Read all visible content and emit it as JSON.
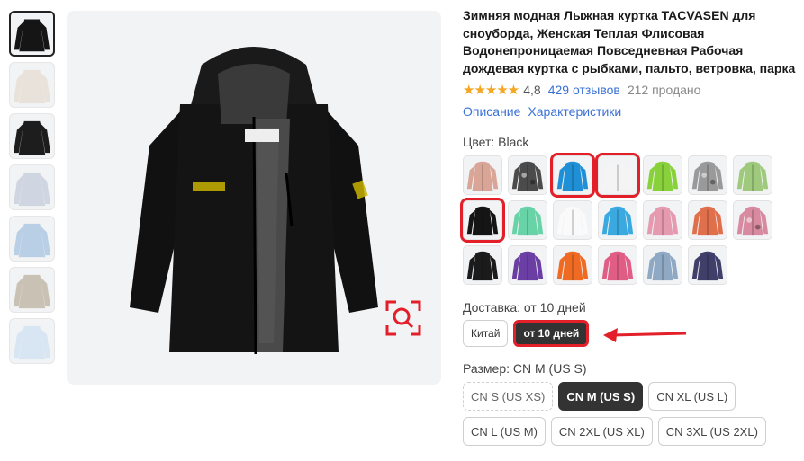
{
  "product": {
    "title": "Зимняя модная Лыжная куртка TACVASEN для сноуборда, Женская Теплая Флисовая Водонепроницаемая Повседневная Рабочая дождевая куртка с рыбками, пальто, ветровка, парка",
    "stars": "★★★★★",
    "rating": "4,8",
    "reviews": "429 отзывов",
    "sold": "212 продано",
    "link_description": "Описание",
    "link_specs": "Характеристики"
  },
  "thumbnails": [
    {
      "name": "thumb-black-jacket",
      "color": "#151515",
      "active": true
    },
    {
      "name": "thumb-hood-detail",
      "color": "#e8e2da"
    },
    {
      "name": "thumb-lining-detail",
      "color": "#1d1d1d"
    },
    {
      "name": "thumb-model-1",
      "color": "#cfd6e2"
    },
    {
      "name": "thumb-model-2",
      "color": "#b9cfe6"
    },
    {
      "name": "thumb-model-3",
      "color": "#c9c1b4"
    },
    {
      "name": "thumb-size-chart",
      "color": "#d8e6f3"
    }
  ],
  "color": {
    "label_prefix": "Цвет:",
    "selected": "Black",
    "swatches": [
      {
        "hex": "#d9a597"
      },
      {
        "hex": "#4b4b4b",
        "pattern": "camo"
      },
      {
        "hex": "#1f8fd6",
        "highlight": true
      },
      {
        "hex": "#f4f4f4",
        "highlight": true
      },
      {
        "hex": "#88d13b"
      },
      {
        "hex": "#9a9a9a",
        "pattern": "camo"
      },
      {
        "hex": "#9fc97d"
      },
      {
        "hex": "#151515",
        "highlight": true
      },
      {
        "hex": "#67d3a6"
      },
      {
        "hex": "#fafafa"
      },
      {
        "hex": "#3aa9e0"
      },
      {
        "hex": "#e59ab0"
      },
      {
        "hex": "#e06f4c"
      },
      {
        "hex": "#d88aa0",
        "pattern": "camo"
      },
      {
        "hex": "#1b1b1b"
      },
      {
        "hex": "#6b3ea3"
      },
      {
        "hex": "#ef6b24"
      },
      {
        "hex": "#e05d85"
      },
      {
        "hex": "#8fa8c4"
      },
      {
        "hex": "#3f3f6a"
      }
    ]
  },
  "delivery": {
    "label": "Доставка: от 10 дней",
    "origin": "Китай",
    "time": "от 10 дней"
  },
  "size": {
    "label": "Размер: CN M (US S)",
    "options": [
      {
        "label": "CN S (US XS)",
        "state": "dashed"
      },
      {
        "label": "CN M (US S)",
        "state": "selected"
      },
      {
        "label": "CN XL (US L)",
        "state": "normal"
      },
      {
        "label": "CN L (US M)",
        "state": "normal"
      },
      {
        "label": "CN 2XL (US XL)",
        "state": "normal"
      },
      {
        "label": "CN 3XL (US 2XL)",
        "state": "normal"
      }
    ]
  },
  "colors": {
    "accent_red": "#e3202a",
    "link_blue": "#3a71d6",
    "star": "#f5a623",
    "dark_chip": "#333333"
  }
}
